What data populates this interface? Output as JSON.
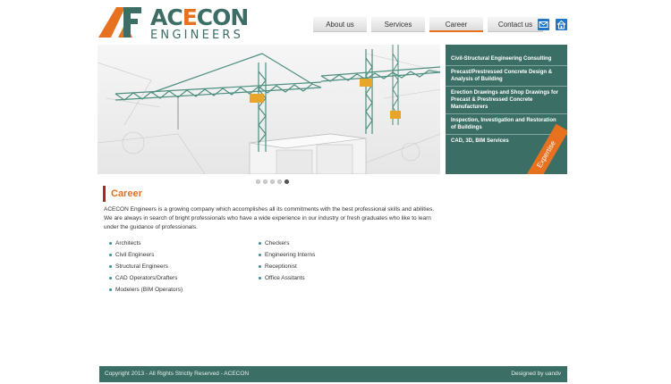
{
  "logo": {
    "word_part1": "AC",
    "word_part2": "E",
    "word_part3": "CON",
    "subtitle": "ENGINEERS"
  },
  "nav": {
    "items": [
      {
        "label": "About us"
      },
      {
        "label": "Services"
      },
      {
        "label": "Career"
      },
      {
        "label": "Contact us"
      }
    ],
    "active": "Career",
    "icons": [
      "mail-icon",
      "home-icon"
    ]
  },
  "expertise": {
    "items": [
      "Civil-Structural Engineering Consulting",
      "Precast/Prestressed Concrete Design & Analysis of Building",
      "Erection Drawings and Shop Drawings for Precast & Prestressed Concrete Manufacturers",
      "Inspection, Investigation and Restoration of Buildings",
      "CAD, 3D, BIM Services"
    ],
    "ribbon": "Expertise"
  },
  "slider": {
    "count": 5,
    "active_index": 4
  },
  "career": {
    "heading": "Career",
    "intro": "ACECON Engineers is a growing company which accomplishes all its commitments with the best professional skills and abilities. We are always in search of bright professionals who have a wide experience in our industry or fresh graduates who like to learn under the guidance of professionals.",
    "positions_left": [
      "Architects",
      "Civil Engineers",
      "Structural Engineers",
      "CAD Operators/Drafters",
      "Modelers (BIM Operators)"
    ],
    "positions_right": [
      "Checkers",
      "Engineering Interns",
      "Receptionist",
      "Office Assitants"
    ]
  },
  "footer": {
    "copyright": "Copyright 2013 - All Rights Strictly Reserved - ACECON",
    "credit": "Designed by uandv"
  },
  "colors": {
    "teal": "#3b6e65",
    "orange": "#e8711f",
    "red": "#b3261e"
  }
}
